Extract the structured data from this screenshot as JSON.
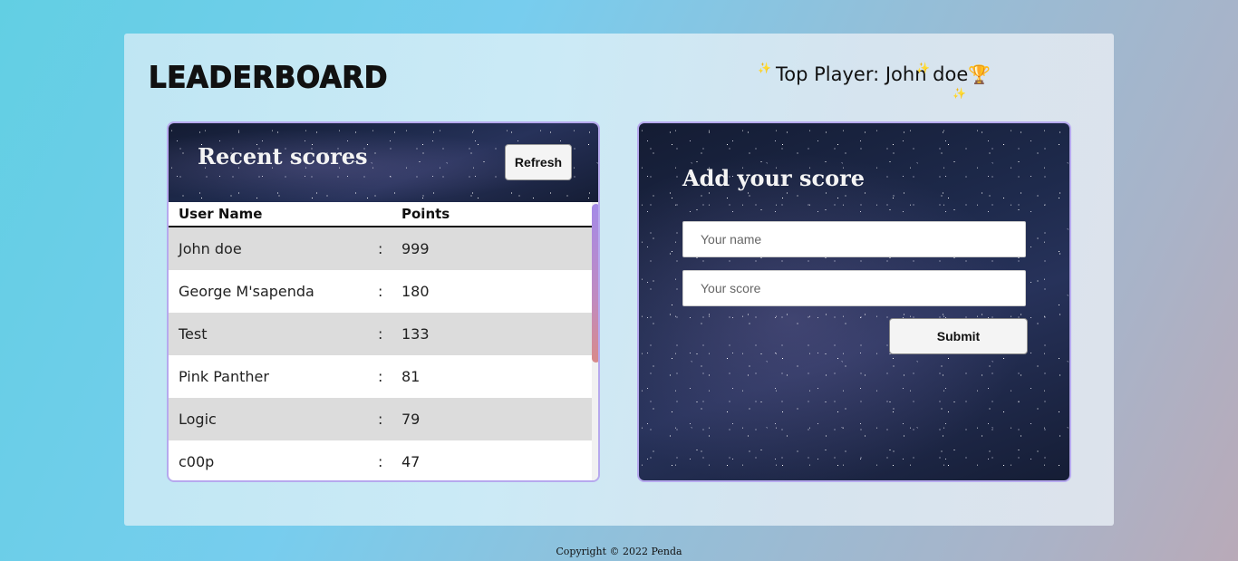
{
  "header": {
    "logo": "LEADERBOARD",
    "top_player_label": "Top Player: John doe",
    "trophy_icon": "🏆",
    "sparkle_icon": "✨"
  },
  "scores": {
    "title": "Recent scores",
    "refresh_label": "Refresh",
    "columns": {
      "name": "User Name",
      "points": "Points"
    },
    "separator": ":",
    "rows": [
      {
        "name": "John doe",
        "points": "999"
      },
      {
        "name": "George M'sapenda",
        "points": "180"
      },
      {
        "name": "Test",
        "points": "133"
      },
      {
        "name": "Pink Panther",
        "points": "81"
      },
      {
        "name": "Logic",
        "points": "79"
      },
      {
        "name": "c00p",
        "points": "47"
      }
    ]
  },
  "add_score": {
    "title": "Add your score",
    "name_placeholder": "Your name",
    "score_placeholder": "Your score",
    "name_value": "",
    "score_value": "",
    "submit_label": "Submit"
  },
  "footer": {
    "copyright": "Copyright © 2022 Penda"
  }
}
